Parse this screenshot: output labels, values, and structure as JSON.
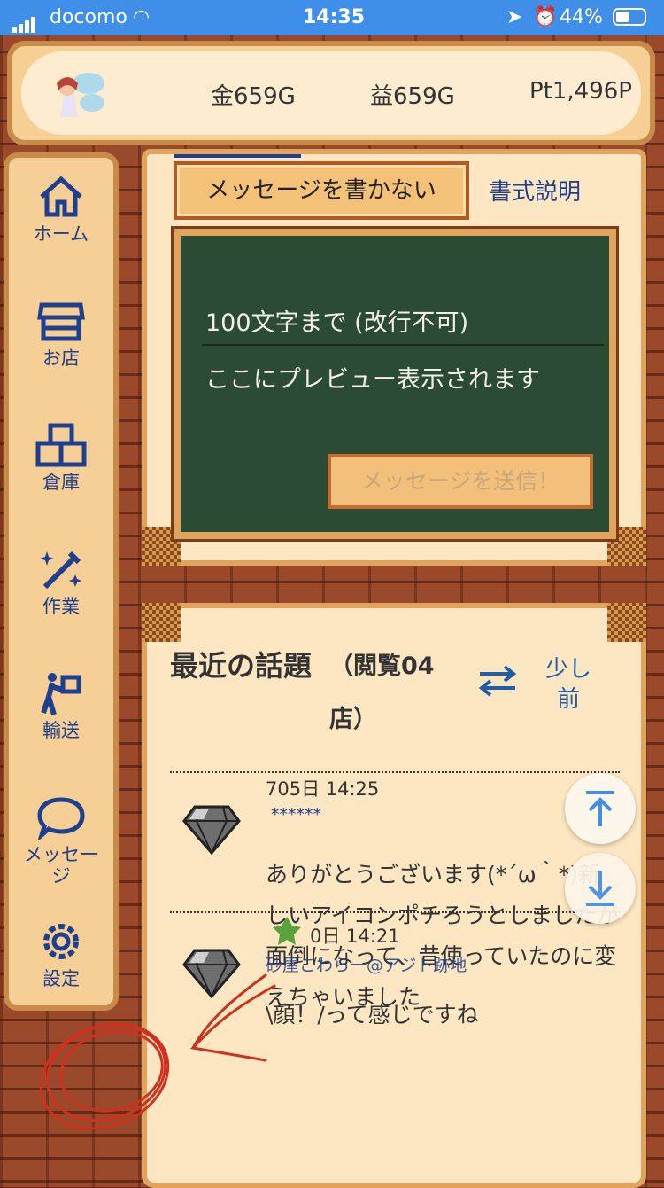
{
  "status": {
    "carrier": "docomo",
    "time": "14:35",
    "battery": "44%"
  },
  "header": {
    "gold": "金659G",
    "profit": "益659G",
    "points": "Pt1,496P"
  },
  "nav": [
    {
      "label": "ホーム",
      "icon": "home-icon"
    },
    {
      "label": "お店",
      "icon": "shop-icon"
    },
    {
      "label": "倉庫",
      "icon": "warehouse-icon"
    },
    {
      "label": "作業",
      "icon": "magic-wand-icon"
    },
    {
      "label": "輸送",
      "icon": "delivery-icon"
    },
    {
      "label": "メッセージ",
      "icon": "chat-bubble-icon"
    },
    {
      "label": "設定",
      "icon": "gear-icon"
    }
  ],
  "composer": {
    "no_write_button": "メッセージを書かない",
    "format_link": "書式説明",
    "placeholder": "100文字まで (改行不可)",
    "preview": "ここにプレビュー表示されます",
    "send_button": "メッセージを送信！"
  },
  "recent": {
    "title": "最近の話題",
    "subtitle": "（閲覧04店）",
    "prev_label": "少し前",
    "messages": [
      {
        "time": "705日 14:25",
        "user": "******",
        "body": "ありがとうございます(*´ω｀*)新しいアイコンポチろうとしましたが面倒になって、昔使っていたのに変えちゃいました"
      },
      {
        "time": "0日 14:21",
        "user": "砂屋こわらー@アジト跡地",
        "body": "\\顔！/って感じですね"
      }
    ]
  },
  "colors": {
    "brand_blue": "#1f3f8f",
    "annotation_red": "#d0301e",
    "board_green": "#2c4b35"
  }
}
